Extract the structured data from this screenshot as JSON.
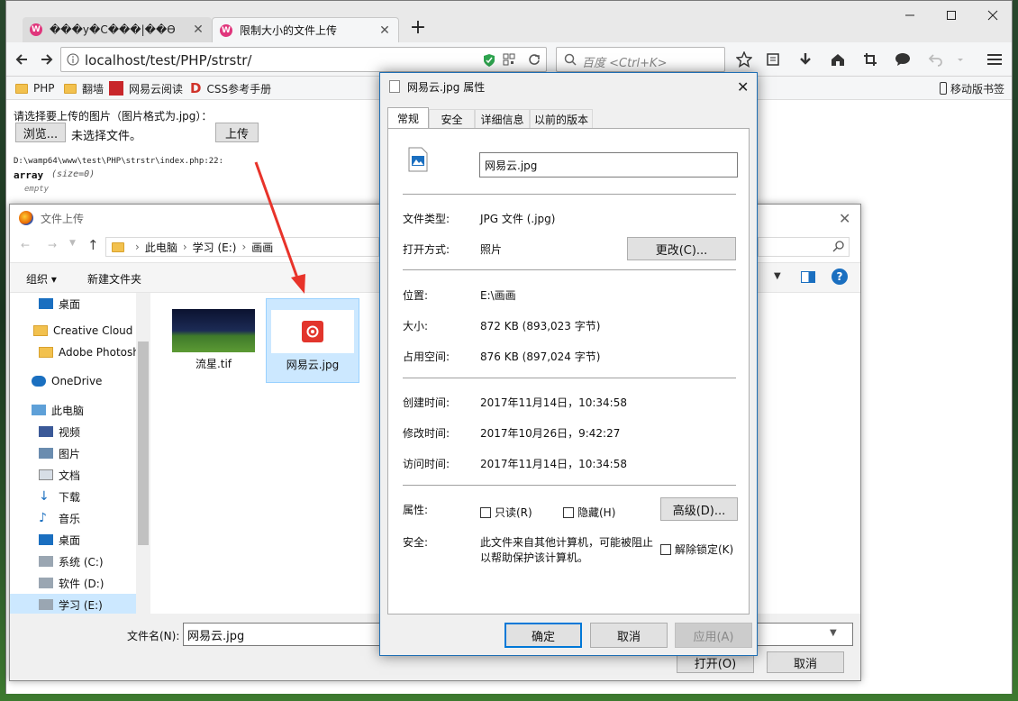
{
  "browser": {
    "tabs": [
      {
        "label": "���y�C���|��Ө",
        "active": false
      },
      {
        "label": "限制大小的文件上传",
        "active": true
      }
    ],
    "url": "localhost/test/PHP/strstr/",
    "search_placeholder": "百度 <Ctrl+K>",
    "bookmarks": [
      "PHP",
      "翻墙",
      "网易云阅读",
      "CSS参考手册"
    ],
    "mobile_bookmarks": "移动版书签"
  },
  "page": {
    "prompt": "请选择要上传的图片（图片格式为.jpg）：",
    "browse_button": "浏览...",
    "no_file": "未选择文件。",
    "upload_button": "上传",
    "dump_path": "D:\\wamp64\\www\\test\\PHP\\strstr\\index.php:22:",
    "dump_type": "array",
    "dump_size": "(size=0)",
    "dump_empty": "empty"
  },
  "file_dialog": {
    "title": "文件上传",
    "breadcrumb": [
      "此电脑",
      "学习 (E:)",
      "画画"
    ],
    "organize": "组织",
    "new_folder": "新建文件夹",
    "nav_items": [
      {
        "label": "桌面",
        "icon": "desktop-icon"
      },
      {
        "label": "Creative Cloud F",
        "icon": "creative-cloud-icon"
      },
      {
        "label": "Adobe Photosh",
        "icon": "folder-icon"
      },
      {
        "label": "OneDrive",
        "icon": "onedrive-icon"
      },
      {
        "label": "此电脑",
        "icon": "computer-icon"
      },
      {
        "label": "视频",
        "icon": "video-icon"
      },
      {
        "label": "图片",
        "icon": "pictures-icon"
      },
      {
        "label": "文档",
        "icon": "documents-icon"
      },
      {
        "label": "下载",
        "icon": "download-icon"
      },
      {
        "label": "音乐",
        "icon": "music-icon"
      },
      {
        "label": "桌面",
        "icon": "desktop-icon"
      },
      {
        "label": "系统 (C:)",
        "icon": "drive-icon"
      },
      {
        "label": "软件 (D:)",
        "icon": "drive-icon"
      },
      {
        "label": "学习 (E:)",
        "icon": "drive-icon"
      }
    ],
    "files": [
      {
        "name": "流星.tif",
        "selected": false
      },
      {
        "name": "网易云.jpg",
        "selected": true
      }
    ],
    "filename_label": "文件名(N):",
    "filename_value": "网易云.jpg",
    "open_button": "打开(O)",
    "cancel_button": "取消"
  },
  "properties": {
    "title": "网易云.jpg 属性",
    "tabs": [
      "常规",
      "安全",
      "详细信息",
      "以前的版本"
    ],
    "filename": "网易云.jpg",
    "type_label": "文件类型:",
    "type_value": "JPG 文件 (.jpg)",
    "open_with_label": "打开方式:",
    "open_with_value": "照片",
    "change_button": "更改(C)...",
    "location_label": "位置:",
    "location_value": "E:\\画画",
    "size_label": "大小:",
    "size_value": "872 KB (893,023 字节)",
    "disk_label": "占用空间:",
    "disk_value": "876 KB (897,024 字节)",
    "created_label": "创建时间:",
    "created_value": "2017年11月14日，10:34:58",
    "modified_label": "修改时间:",
    "modified_value": "2017年10月26日，9:42:27",
    "accessed_label": "访问时间:",
    "accessed_value": "2017年11月14日，10:34:58",
    "attributes_label": "属性:",
    "readonly": "只读(R)",
    "hidden": "隐藏(H)",
    "advanced_button": "高级(D)...",
    "security_label": "安全:",
    "security_text_1": "此文件来自其他计算机，可能被阻止",
    "security_text_2": "以帮助保护该计算机。",
    "unblock": "解除锁定(K)",
    "ok_button": "确定",
    "cancel_button": "取消",
    "apply_button": "应用(A)"
  },
  "colors": {
    "arrow": "#e8332a",
    "selection": "#cce8ff",
    "accent": "#0078d7"
  }
}
